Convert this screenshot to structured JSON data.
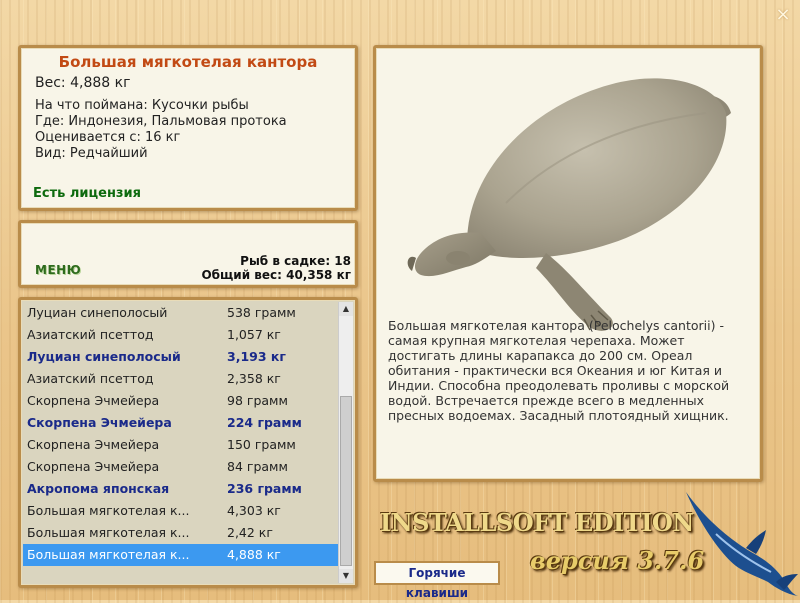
{
  "window": {
    "close_label": "×"
  },
  "info": {
    "title": "Большая мягкотелая кантора",
    "weight": "Вес: 4,888 кг",
    "caught_on": "На что поймана: Кусочки рыбы",
    "location": "Где: Индонезия, Пальмовая протока",
    "valued_from": "Оценивается с: 16 кг",
    "rarity": "Вид: Редчайший",
    "license": "Есть лицензия"
  },
  "menu": {
    "label": "МЕНЮ",
    "keep_count": "Рыб в садке: 18",
    "total_weight": "Общий вес: 40,358 кг"
  },
  "catch_list": [
    {
      "name": "Луциан синеполосый",
      "weight": "538 грамм",
      "style": "normal"
    },
    {
      "name": "Азиатский псеттод",
      "weight": "1,057 кг",
      "style": "normal"
    },
    {
      "name": "Луциан синеполосый",
      "weight": "3,193 кг",
      "style": "bold"
    },
    {
      "name": "Азиатский псеттод",
      "weight": "2,358 кг",
      "style": "normal"
    },
    {
      "name": "Скорпена Эчмейера",
      "weight": "98 грамм",
      "style": "normal"
    },
    {
      "name": "Скорпена Эчмейера",
      "weight": "224 грамм",
      "style": "bold"
    },
    {
      "name": "Скорпена Эчмейера",
      "weight": "150 грамм",
      "style": "normal"
    },
    {
      "name": "Скорпена Эчмейера",
      "weight": "84 грамм",
      "style": "normal"
    },
    {
      "name": "Акропома японская",
      "weight": "236 грамм",
      "style": "bold"
    },
    {
      "name": "Большая мягкотелая к...",
      "weight": "4,303 кг",
      "style": "normal"
    },
    {
      "name": "Большая мягкотелая к...",
      "weight": "2,42 кг",
      "style": "normal"
    },
    {
      "name": "Большая мягкотелая к...",
      "weight": "4,888 кг",
      "style": "selected"
    }
  ],
  "scrollbar": {
    "up_icon": "▲",
    "down_icon": "▼"
  },
  "description": "Большая мягкотелая кантора (Pelochelys cantorii) - самая крупная мягкотелая черепаха. Может достигать длины карапакса до 200 см. Ореал обитания - практически вся Океания и юг Китая и Индии. Способна преодолевать проливы с морской водой. Встречается прежде всего в медленных пресных водоемах. Засадный плотоядный хищник.",
  "hotkeys_label": "Горячие клавиши",
  "branding": {
    "edition": "INSTALLSOFT EDITION",
    "version": "версия 3.7.6"
  },
  "colors": {
    "title": "#c24a14",
    "license": "#0d6a0d",
    "highlight": "#3c99f0",
    "bold_row": "#1a2a8a"
  }
}
